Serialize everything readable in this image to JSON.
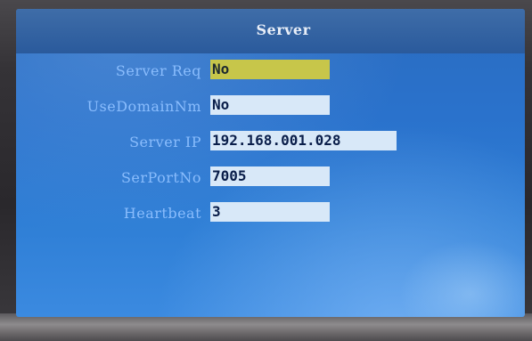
{
  "screen": {
    "title": "Server",
    "fields": [
      {
        "label": "Server Req",
        "value": "No",
        "selected": true
      },
      {
        "label": "UseDomainNm",
        "value": "No",
        "selected": false
      },
      {
        "label": "Server IP",
        "value": "192.168.001.028",
        "selected": false
      },
      {
        "label": "SerPortNo",
        "value": "7005",
        "selected": false
      },
      {
        "label": "Heartbeat",
        "value": "3",
        "selected": false
      }
    ]
  },
  "colors": {
    "selected_field": "#c7c64a",
    "field": "#d8e8f8",
    "label_text": "#8ec0ff",
    "screen_bg": "#2a72cc"
  }
}
